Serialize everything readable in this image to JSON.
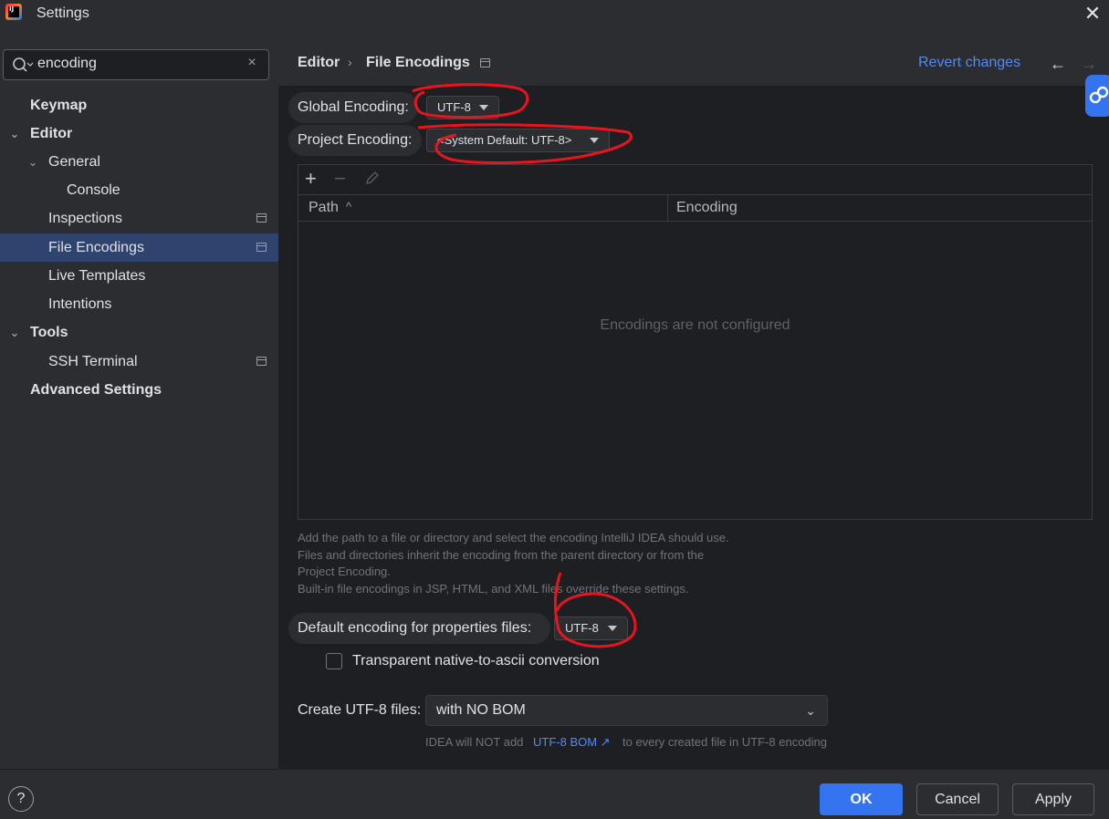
{
  "window": {
    "title": "Settings",
    "close_label": "✕"
  },
  "search": {
    "value": "encoding",
    "clear": "×"
  },
  "sidebar": {
    "items": [
      {
        "label": "Keymap"
      },
      {
        "label": "Editor"
      },
      {
        "label": "General"
      },
      {
        "label": "Console"
      },
      {
        "label": "Inspections"
      },
      {
        "label": "File Encodings"
      },
      {
        "label": "Live Templates"
      },
      {
        "label": "Intentions"
      },
      {
        "label": "Tools"
      },
      {
        "label": "SSH Terminal"
      },
      {
        "label": "Advanced Settings"
      }
    ]
  },
  "breadcrumb": {
    "parent": "Editor",
    "separator": "›",
    "current": "File Encodings"
  },
  "header": {
    "revert": "Revert changes",
    "back": "←",
    "forward": "→"
  },
  "global_encoding": {
    "label": "Global Encoding:",
    "value": "UTF-8"
  },
  "project_encoding": {
    "label": "Project Encoding:",
    "value": "<System Default: UTF-8>"
  },
  "toolbar": {
    "add": "+",
    "remove": "−"
  },
  "table": {
    "columns": [
      "Path",
      "Encoding"
    ],
    "sort_indicator": "^",
    "empty_text": "Encodings are not configured"
  },
  "help_text": [
    "Add the path to a file or directory and select the encoding IntelliJ IDEA should use.",
    "Files and directories inherit the encoding from the parent directory or from the",
    "Project Encoding.",
    "Built-in file encodings in JSP, HTML, and XML files override these settings."
  ],
  "properties_encoding": {
    "label": "Default encoding for properties files:",
    "value": "UTF-8"
  },
  "transparent_conversion": {
    "label": "Transparent native-to-ascii conversion",
    "checked": false
  },
  "utf8_files": {
    "label": "Create UTF-8 files:",
    "value": "with NO BOM",
    "note_prefix": "IDEA will NOT add",
    "note_link": "UTF-8 BOM ↗",
    "note_suffix": "to every created file in UTF-8 encoding"
  },
  "footer": {
    "help": "?",
    "ok": "OK",
    "cancel": "Cancel",
    "apply": "Apply"
  },
  "colors": {
    "accent": "#3574f0",
    "link": "#548af7",
    "selection": "#2e436e",
    "annotation": "#e8141e"
  }
}
